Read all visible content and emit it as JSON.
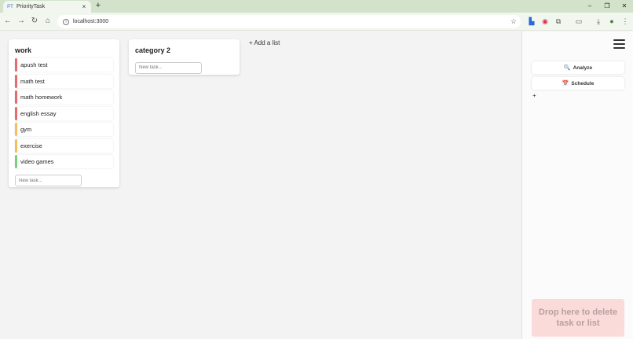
{
  "browser": {
    "tab_title": "PriorityTask",
    "tab_close": "×",
    "new_tab": "+",
    "favicon": "PT",
    "window": {
      "minimize": "–",
      "restore": "❐",
      "close": "✕"
    },
    "nav": {
      "back": "←",
      "forward": "→",
      "reload": "↻",
      "home": "⌂"
    },
    "url": "localhost:3000",
    "bookmark": "☆",
    "extensions": {
      "ext1": "▙",
      "ext2": "◉",
      "ext3": "⧉",
      "ext4": "▭",
      "download": "⤓",
      "profile": "●",
      "menu": "⋮"
    }
  },
  "board": {
    "add_list_label": "+ Add a list",
    "lists": [
      {
        "title": "work",
        "new_task_placeholder": "New task...",
        "tasks": [
          {
            "label": "apush test",
            "color": "#e86a6a"
          },
          {
            "label": "math test",
            "color": "#e86a6a"
          },
          {
            "label": "math homework",
            "color": "#e86a6a"
          },
          {
            "label": "english essay",
            "color": "#e86a6a"
          },
          {
            "label": "gym",
            "color": "#f2c05a"
          },
          {
            "label": "exercise",
            "color": "#f2c05a"
          },
          {
            "label": "video games",
            "color": "#7ccf7c"
          }
        ]
      },
      {
        "title": "category 2",
        "new_task_placeholder": "New task...",
        "tasks": []
      }
    ]
  },
  "sidebar": {
    "analyze_label": "Analyze",
    "analyze_icon": "🔍",
    "schedule_label": "Schedule",
    "schedule_icon": "📅",
    "plus": "+",
    "dropzone_text": "Drop here to delete task or list"
  }
}
